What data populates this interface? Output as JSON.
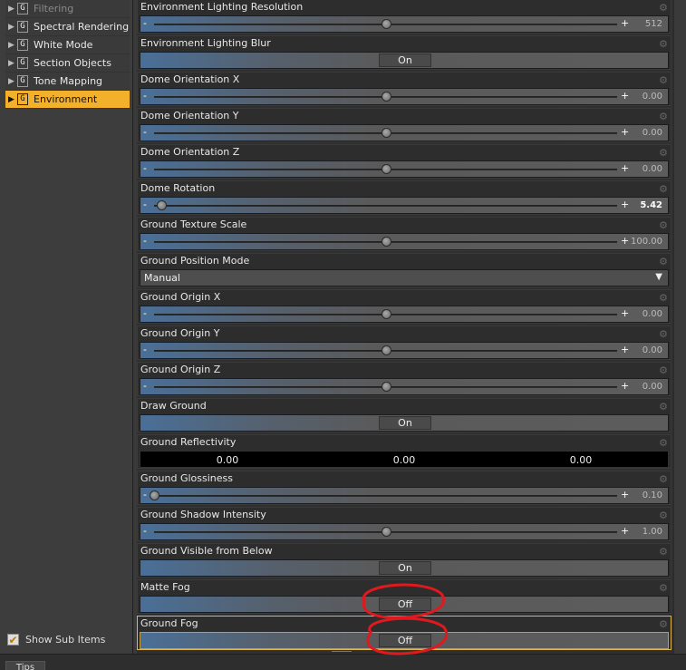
{
  "sidebar": {
    "items": [
      {
        "label": "Filtering",
        "icon": "g-icon",
        "state": "dim"
      },
      {
        "label": "Spectral Rendering",
        "icon": "g-icon",
        "state": "normal"
      },
      {
        "label": "White Mode",
        "icon": "g-icon",
        "state": "normal"
      },
      {
        "label": "Section Objects",
        "icon": "g-icon",
        "state": "normal"
      },
      {
        "label": "Tone Mapping",
        "icon": "g-icon",
        "state": "normal"
      },
      {
        "label": "Environment",
        "icon": "g-icon",
        "state": "active"
      }
    ],
    "group_glyph": "G",
    "expand_glyph": "▶",
    "show_sub_items_label": "Show Sub Items",
    "show_sub_items_checked": true
  },
  "properties": [
    {
      "label": "Environment Lighting Resolution",
      "type": "slider",
      "value": "512",
      "position": 0.5
    },
    {
      "label": "Environment Lighting Blur",
      "type": "toggle",
      "value": "On"
    },
    {
      "label": "Dome Orientation X",
      "type": "slider",
      "value": "0.00",
      "position": 0.5
    },
    {
      "label": "Dome Orientation Y",
      "type": "slider",
      "value": "0.00",
      "position": 0.5
    },
    {
      "label": "Dome Orientation Z",
      "type": "slider",
      "value": "0.00",
      "position": 0.5
    },
    {
      "label": "Dome Rotation",
      "type": "slider",
      "value": "5.42",
      "position": 0.015,
      "bright": true
    },
    {
      "label": "Ground Texture Scale",
      "type": "slider",
      "value": "100.00",
      "position": 0.5
    },
    {
      "label": "Ground Position Mode",
      "type": "dropdown",
      "value": "Manual"
    },
    {
      "label": "Ground Origin X",
      "type": "slider",
      "value": "0.00",
      "position": 0.5
    },
    {
      "label": "Ground Origin Y",
      "type": "slider",
      "value": "0.00",
      "position": 0.5
    },
    {
      "label": "Ground Origin Z",
      "type": "slider",
      "value": "0.00",
      "position": 0.5
    },
    {
      "label": "Draw Ground",
      "type": "toggle",
      "value": "On"
    },
    {
      "label": "Ground Reflectivity",
      "type": "color",
      "values": [
        "0.00",
        "0.00",
        "0.00"
      ]
    },
    {
      "label": "Ground Glossiness",
      "type": "slider",
      "value": "0.10",
      "position": 0.0
    },
    {
      "label": "Ground Shadow Intensity",
      "type": "slider",
      "value": "1.00",
      "position": 0.5
    },
    {
      "label": "Ground Visible from Below",
      "type": "toggle",
      "value": "On"
    },
    {
      "label": "Matte Fog",
      "type": "toggle",
      "value": "Off"
    },
    {
      "label": "Ground Fog",
      "type": "toggle",
      "value": "Off",
      "highlighted": true
    }
  ],
  "glyphs": {
    "minus": "-",
    "plus": "+",
    "gear": "⚙",
    "dropdown_arrow": "▼",
    "check": "✔"
  },
  "bottom_tabs": [
    {
      "label": "Tips"
    }
  ],
  "colors": {
    "accent": "#f3b12b",
    "annotation": "#e0191e",
    "panel": "#2d2d2d"
  }
}
